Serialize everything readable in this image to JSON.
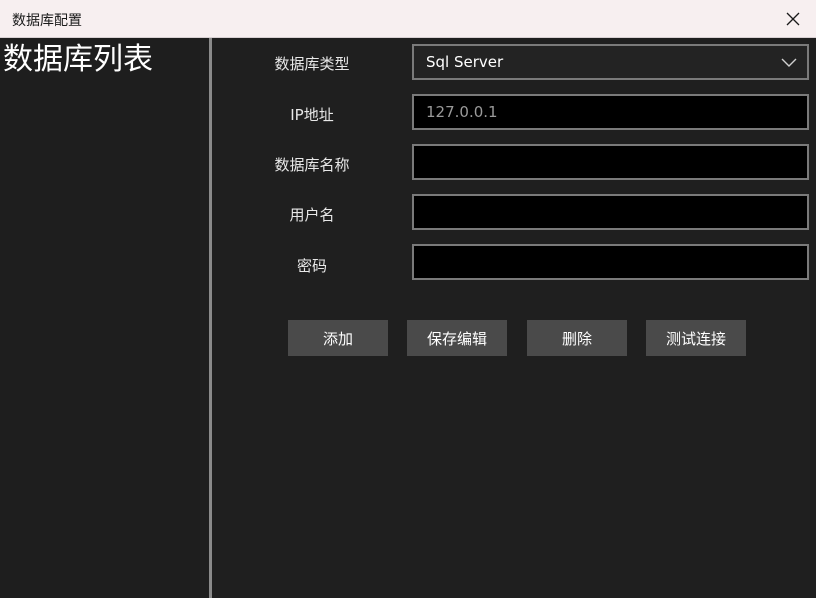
{
  "window": {
    "title": "数据库配置",
    "close_icon": "close-icon"
  },
  "sidebar": {
    "title": "数据库列表"
  },
  "form": {
    "db_type": {
      "label": "数据库类型",
      "value": "Sql Server",
      "icon": "chevron-down-icon"
    },
    "ip": {
      "label": "IP地址",
      "value": "127.0.0.1"
    },
    "db_name": {
      "label": "数据库名称",
      "value": ""
    },
    "username": {
      "label": "用户名",
      "value": ""
    },
    "password": {
      "label": "密码",
      "value": ""
    }
  },
  "buttons": {
    "add": "添加",
    "save_edit": "保存编辑",
    "delete": "删除",
    "test_connection": "测试连接"
  },
  "colors": {
    "background": "#1f1f1f",
    "field_background": "#000000",
    "field_border": "#7a7a7a",
    "button_background": "#4a4a4a",
    "titlebar_background": "#f7eff0"
  }
}
